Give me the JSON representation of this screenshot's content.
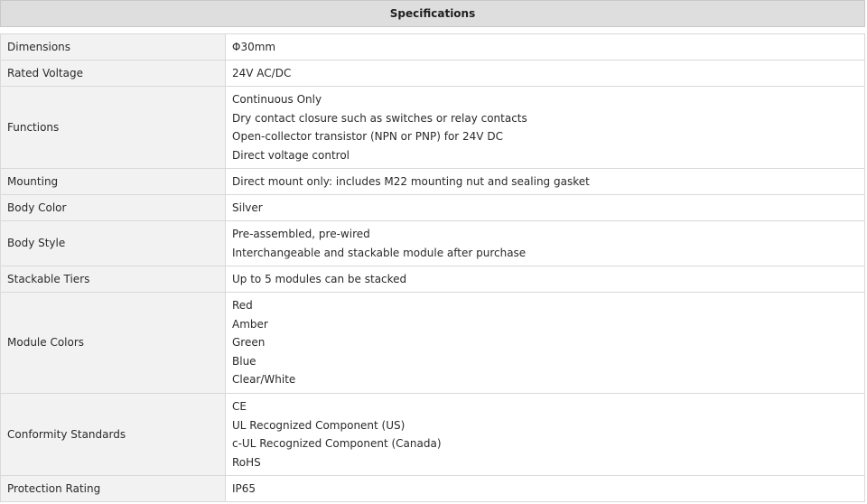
{
  "header": {
    "title": "Specifications"
  },
  "rows": [
    {
      "label": "Dimensions",
      "values": [
        "Φ30mm"
      ]
    },
    {
      "label": "Rated Voltage",
      "values": [
        "24V AC/DC"
      ]
    },
    {
      "label": "Functions",
      "values": [
        "Continuous Only",
        "Dry contact closure such as switches or relay contacts",
        "Open-collector transistor (NPN or PNP) for 24V DC",
        "Direct voltage control"
      ]
    },
    {
      "label": "Mounting",
      "values": [
        "Direct mount only: includes M22 mounting nut and sealing gasket"
      ]
    },
    {
      "label": "Body Color",
      "values": [
        "Silver"
      ]
    },
    {
      "label": "Body Style",
      "values": [
        "Pre-assembled, pre-wired",
        "Interchangeable and stackable module after purchase"
      ]
    },
    {
      "label": "Stackable Tiers",
      "values": [
        "Up to 5 modules can be stacked"
      ]
    },
    {
      "label": "Module Colors",
      "values": [
        "Red",
        "Amber",
        "Green",
        "Blue",
        "Clear/White"
      ]
    },
    {
      "label": "Conformity Standards",
      "values": [
        "CE",
        "UL Recognized Component (US)",
        "c-UL Recognized Component (Canada)",
        "RoHS"
      ]
    },
    {
      "label": "Protection Rating",
      "values": [
        "IP65"
      ]
    }
  ]
}
